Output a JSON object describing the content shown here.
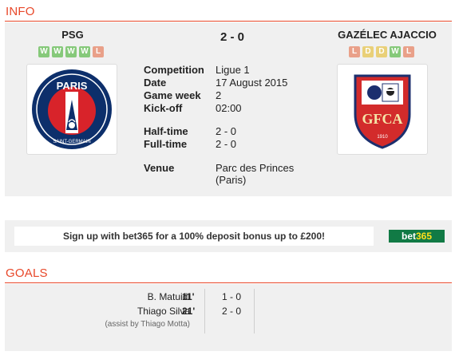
{
  "info_section": {
    "title": "INFO"
  },
  "home": {
    "name": "PSG",
    "form": [
      "W",
      "W",
      "W",
      "W",
      "L"
    ],
    "logo_text": {
      "top": "PARIS",
      "bottom": "SAINT-GERMAIN"
    }
  },
  "away": {
    "name": "GAZÉLEC AJACCIO",
    "form": [
      "L",
      "D",
      "D",
      "W",
      "L"
    ],
    "logo_text": {
      "main": "GFCA",
      "year": "1910"
    }
  },
  "score": "2 - 0",
  "details": [
    {
      "label": "Competition",
      "value": "Ligue 1"
    },
    {
      "label": "Date",
      "value": "17 August 2015"
    },
    {
      "label": "Game week",
      "value": "2"
    },
    {
      "label": "Kick-off",
      "value": "02:00"
    },
    {
      "label": "Half-time",
      "value": "2 - 0"
    },
    {
      "label": "Full-time",
      "value": "2 - 0"
    },
    {
      "label": "Venue",
      "value": "Parc des Princes (Paris)"
    }
  ],
  "ad": {
    "text": "Sign up with bet365 for a 100% deposit bonus up to £200!",
    "logo_left": "bet",
    "logo_right": "365"
  },
  "goals_section": {
    "title": "GOALS"
  },
  "goals": [
    {
      "scorer": "B. Matuidi",
      "minute": "11'",
      "score": "1 - 0",
      "assist": ""
    },
    {
      "scorer": "Thiago Silva",
      "minute": "21'",
      "score": "2 - 0",
      "assist": "(assist by Thiago Motta)"
    }
  ],
  "colors": {
    "accent": "#e8482a",
    "panel": "#f0f0f0",
    "form_win": "#86c97a",
    "form_loss": "#e9a089",
    "form_draw": "#e9d078",
    "bet365_green": "#117a45",
    "bet365_yellow": "#ffdf1b",
    "psg_navy": "#0d2f6b",
    "psg_red": "#d8232a",
    "gfca_red": "#d32b2b",
    "gfca_navy": "#1c2f6e"
  }
}
